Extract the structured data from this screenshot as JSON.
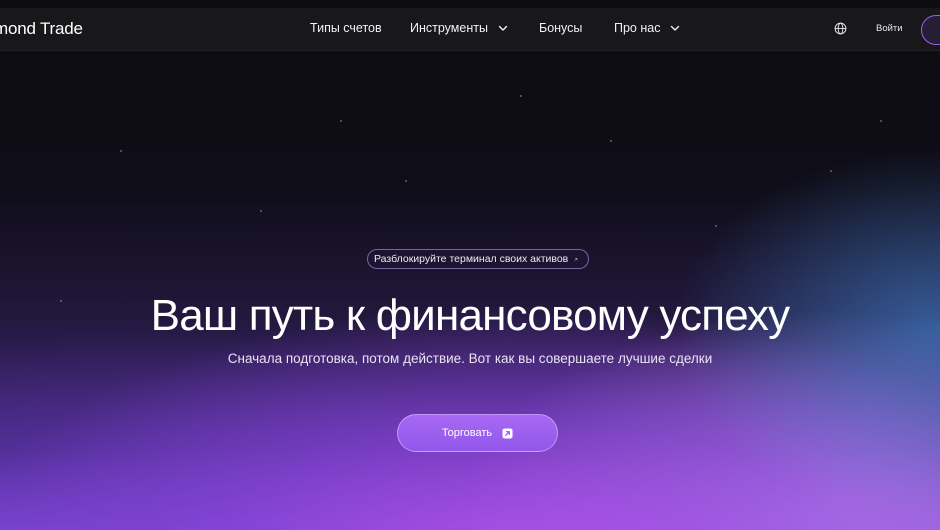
{
  "header": {
    "logo_text": "mond Trade",
    "nav": [
      {
        "label": "Типы счетов",
        "has_dropdown": false
      },
      {
        "label": "Инструменты",
        "has_dropdown": true
      },
      {
        "label": "Бонусы",
        "has_dropdown": false
      },
      {
        "label": "Про нас",
        "has_dropdown": true
      }
    ],
    "globe_icon": "globe-icon",
    "login_label": "Войти"
  },
  "hero": {
    "badge_text": "Разблокируйте терминал своих активов",
    "badge_icon": "arrow-up-right-icon",
    "title": "Ваш путь к финансовому успеху",
    "subtitle": "Сначала подготовка, потом действие. Вот как вы совершаете лучшие сделки",
    "cta_label": "Торговать",
    "cta_icon": "external-square-icon"
  },
  "colors": {
    "header_bg": "#18181b",
    "accent": "#9b5cf0",
    "cta_bg": "#9b60ef"
  }
}
